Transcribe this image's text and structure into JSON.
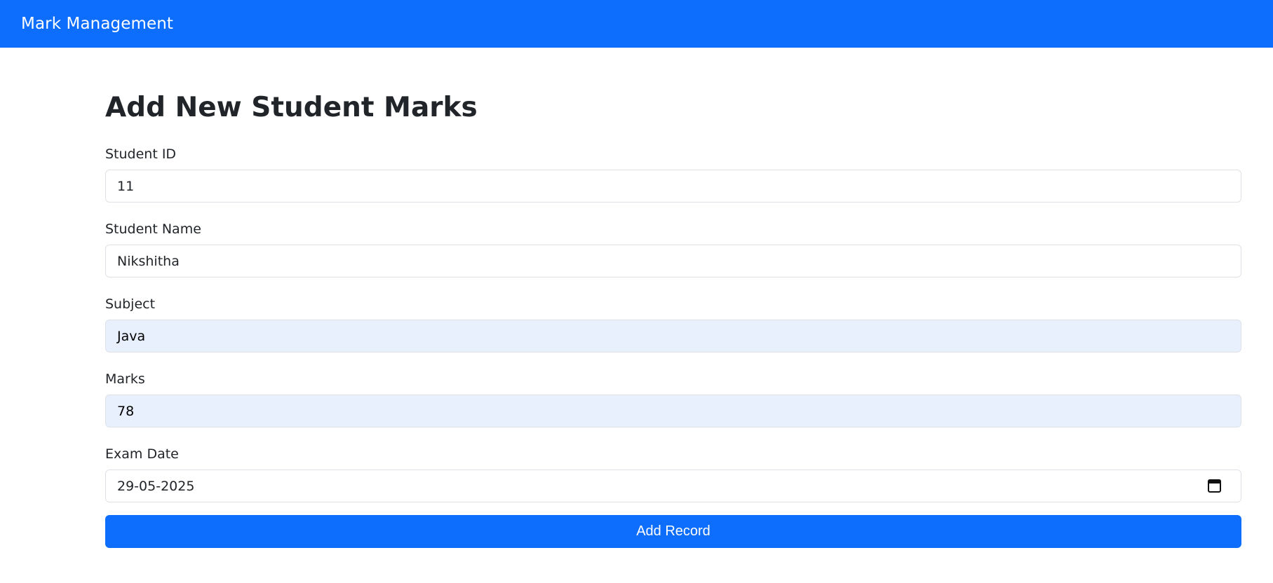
{
  "navbar": {
    "brand": "Mark Management",
    "accent_color": "#0d6efd"
  },
  "page": {
    "title": "Add New Student Marks"
  },
  "form": {
    "fields": [
      {
        "label": "Student ID",
        "value": "11",
        "autofilled": false
      },
      {
        "label": "Student Name",
        "value": "Nikshitha",
        "autofilled": false
      },
      {
        "label": "Subject",
        "value": "Java",
        "autofilled": true
      },
      {
        "label": "Marks",
        "value": "78",
        "autofilled": true
      },
      {
        "label": "Exam Date",
        "value": "29-05-2025",
        "autofilled": false,
        "icon": "calendar-icon"
      }
    ],
    "submit_label": "Add Record"
  }
}
